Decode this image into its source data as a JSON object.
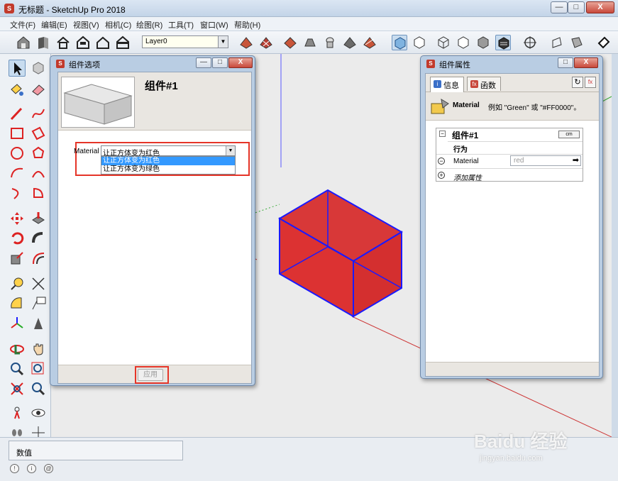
{
  "window": {
    "title": "无标题 - SketchUp Pro 2018",
    "icon_letter": "S",
    "controls": [
      "—",
      "□",
      "X"
    ]
  },
  "menu": [
    "文件(F)",
    "编辑(E)",
    "视图(V)",
    "相机(C)",
    "绘图(R)",
    "工具(T)",
    "窗口(W)",
    "帮助(H)"
  ],
  "toolbar": {
    "layer": {
      "value": "Layer0",
      "arrow": "▼"
    }
  },
  "status_bar": {
    "measurements_label": "数值",
    "icons": [
      "!",
      "i",
      "@"
    ]
  },
  "component_options": {
    "title": "组件选项",
    "controls": [
      "—",
      "□",
      "X"
    ],
    "name": "组件#1",
    "material_label": "Material",
    "selected_value": "让正方体变为红色",
    "arrow": "▼",
    "options": [
      "让正方体变为红色",
      "让正方体变为绿色"
    ],
    "apply_label": "应用"
  },
  "component_attributes": {
    "title": "组件属性",
    "controls": [
      "□",
      "X"
    ],
    "tabs": [
      {
        "label": "信息",
        "icon": "info-icon",
        "icon_glyph": "i",
        "icon_color": "#3a6fc8"
      },
      {
        "label": "函数",
        "icon": "function-icon",
        "icon_glyph": "fx",
        "icon_color": "#c8473a"
      }
    ],
    "toolbar_glyphs": {
      "refresh": "↻",
      "function": "fx"
    },
    "hint_name": "Material",
    "hint_text": "例如 \"Green\" 或 \"#FF0000\"。",
    "component_name": "组件#1",
    "unit_badge": "cm",
    "behavior_label": "行为",
    "material_label": "Material",
    "material_value": "red",
    "add_attribute_label": "添加属性",
    "glyphs": {
      "collapse": "−",
      "remove": "−",
      "add": "+",
      "go": "➡"
    }
  },
  "watermark": {
    "text": "Baidu 经验",
    "url_text": "jingyan.baidu.com"
  },
  "colors": {
    "cube_fill": "#dc3232",
    "cube_edges": "#1a1aff",
    "highlight_box": "#e53528",
    "selection": "#3399ff"
  }
}
